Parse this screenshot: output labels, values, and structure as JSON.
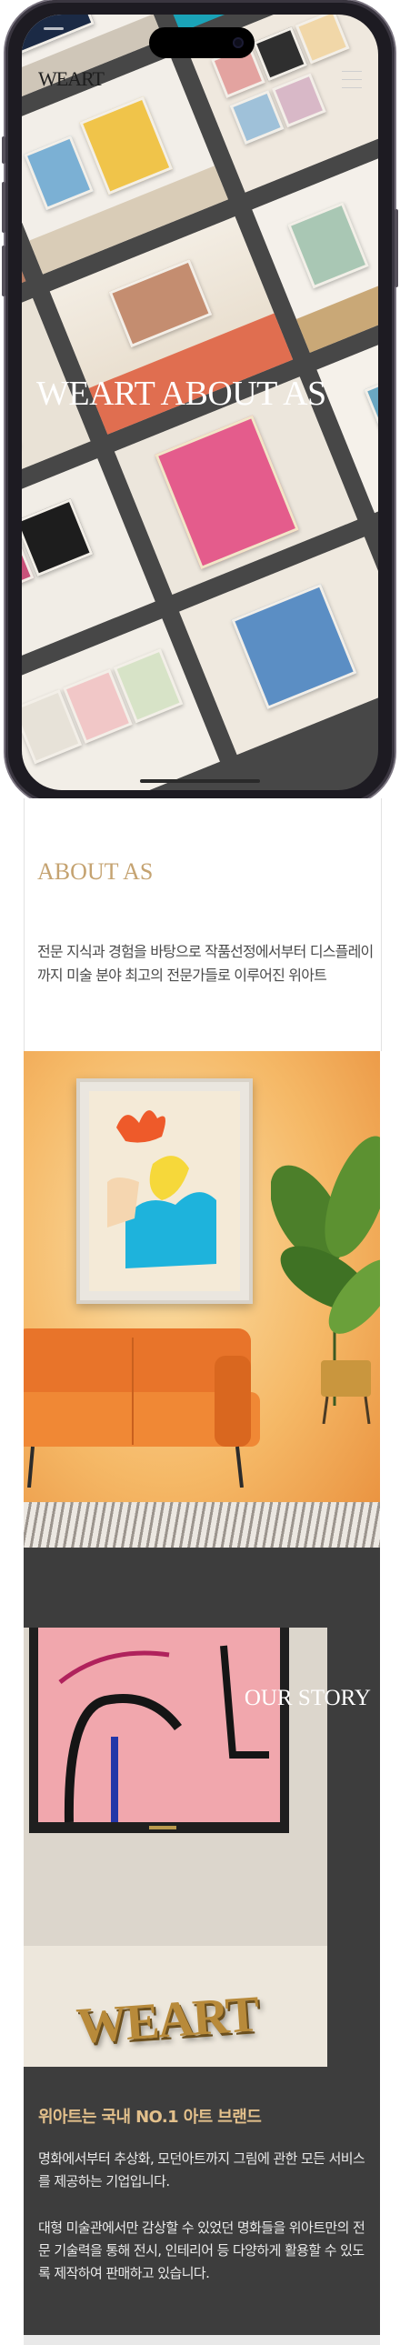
{
  "header": {
    "logo": "WEART",
    "menu_icon": "hamburger-menu-icon"
  },
  "hero": {
    "title": "WEART ABOUT AS"
  },
  "about": {
    "heading": "ABOUT AS",
    "description": "전문 지식과 경험을 바탕으로 작품선정에서부터 디스플레이까지 미술 분야 최고의 전문가들로 이루어진 위아트"
  },
  "story": {
    "heading": "OUR STORY",
    "tagline": "위아트는 국내 NO.1 아트 브랜드",
    "paragraph_1": "명화에서부터 추상화, 모던아트까지 그림에 관한 모든 서비스를 제공하는 기업입니다.",
    "paragraph_2": "대형 미술관에서만 감상할 수 있었던 명화들을 위아트만의 전문 기술력을 통해 전시, 인테리어 등 다양하게 활용할 수 있도록 제작하여 판매하고 있습니다.",
    "sign_text": "WEART"
  },
  "colors": {
    "accent_gold": "#c5a371",
    "tagline_gold": "#e3c08b",
    "dark_bg": "#3d3d3d"
  }
}
